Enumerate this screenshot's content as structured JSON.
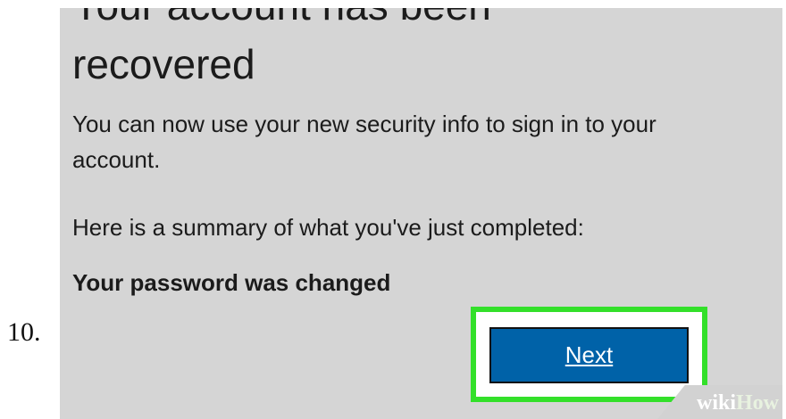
{
  "step_number": "10.",
  "dialog": {
    "heading_line1": "Your account has been",
    "heading_line2": "recovered",
    "description": "You can now use your new security info to sign in to your account.",
    "summary_intro": "Here is a summary of what you've just completed:",
    "summary_item": "Your password was changed",
    "next_label": "Next"
  },
  "watermark": {
    "part1": "wiki",
    "part2": "How"
  },
  "colors": {
    "background": "#d5d5d5",
    "button": "#0062a8",
    "highlight": "#33e02a"
  }
}
